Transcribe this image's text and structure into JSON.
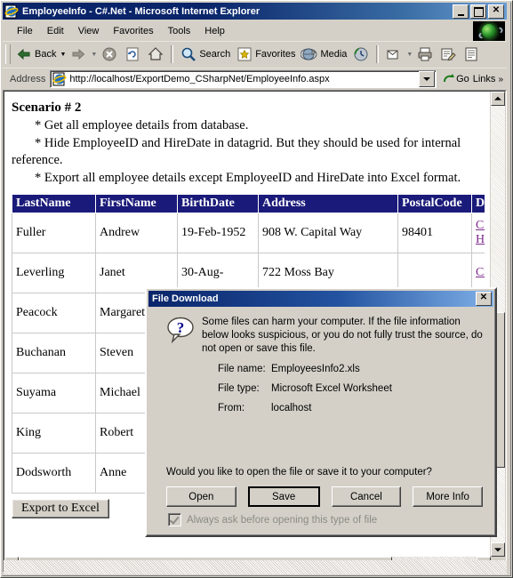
{
  "window": {
    "title": "EmployeeInfo - C#.Net - Microsoft Internet Explorer",
    "icon": "ie-document-icon",
    "minimize_label": "_",
    "maximize_label": "□",
    "close_label": "✕"
  },
  "menu": {
    "items": [
      {
        "label": "File"
      },
      {
        "label": "Edit"
      },
      {
        "label": "View"
      },
      {
        "label": "Favorites"
      },
      {
        "label": "Tools"
      },
      {
        "label": "Help"
      }
    ]
  },
  "toolbar": {
    "back_label": "Back",
    "forward_label": "",
    "stop_label": "",
    "refresh_label": "",
    "home_label": "",
    "search_label": "Search",
    "favorites_label": "Favorites",
    "media_label": "Media",
    "history_label": "",
    "mail_label": "",
    "print_label": "",
    "edit_label": "",
    "discuss_label": ""
  },
  "address": {
    "label": "Address",
    "url": "http://localhost/ExportDemo_CSharpNet/EmployeeInfo.aspx",
    "go_label": "Go",
    "links_label": "Links",
    "chevron": "»"
  },
  "page": {
    "heading": "Scenario # 2",
    "bullets": [
      "* Get all employee details from database.",
      "* Hide EmployeeID and HireDate in datagrid. But they should be used for internal reference.",
      "* Export all employee details except EmployeeID and HireDate into Excel format."
    ],
    "grid": {
      "columns": [
        "LastName",
        "FirstName",
        "BirthDate",
        "Address",
        "PostalCode",
        "Details"
      ],
      "rows": [
        {
          "LastName": "Fuller",
          "FirstName": "Andrew",
          "BirthDate": "19-Feb-1952",
          "Address": "908 W. Capital Way",
          "PostalCode": "98401",
          "Details": "Click Here"
        },
        {
          "LastName": "Leverling",
          "FirstName": "Janet",
          "BirthDate": "30-Aug-",
          "Address": "722 Moss Bay",
          "PostalCode": "",
          "Details": "Click"
        },
        {
          "LastName": "Peacock",
          "FirstName": "Margaret",
          "BirthDate": "",
          "Address": "",
          "PostalCode": "",
          "Details": ""
        },
        {
          "LastName": "Buchanan",
          "FirstName": "Steven",
          "BirthDate": "",
          "Address": "",
          "PostalCode": "",
          "Details": ""
        },
        {
          "LastName": "Suyama",
          "FirstName": "Michael",
          "BirthDate": "",
          "Address": "",
          "PostalCode": "",
          "Details": ""
        },
        {
          "LastName": "King",
          "FirstName": "Robert",
          "BirthDate": "",
          "Address": "",
          "PostalCode": "",
          "Details": ""
        },
        {
          "LastName": "Dodsworth",
          "FirstName": "Anne",
          "BirthDate": "",
          "Address": "",
          "PostalCode": "",
          "Details": ""
        }
      ],
      "header_bg": "#1a1a7a",
      "link_color": "#7a2a8a"
    },
    "export_button_label": "Export to Excel"
  },
  "dialog": {
    "title": "File Download",
    "close_label": "✕",
    "icon": "question-balloon-icon",
    "warning": "Some files can harm your computer. If the file information below looks suspicious, or you do not fully trust the source, do not open or save this file.",
    "fields": [
      {
        "key": "File name:",
        "value": "EmployeesInfo2.xls"
      },
      {
        "key": "File type:",
        "value": "Microsoft Excel Worksheet"
      },
      {
        "key": "From:",
        "value": "localhost"
      }
    ],
    "question": "Would you like to open the file or save it to your computer?",
    "buttons": [
      {
        "label": "Open",
        "default": false
      },
      {
        "label": "Save",
        "default": true
      },
      {
        "label": "Cancel",
        "default": false
      },
      {
        "label": "More Info",
        "default": false
      }
    ],
    "checkbox": {
      "label": "Always ask before opening this type of file",
      "checked": true,
      "disabled": true
    }
  }
}
